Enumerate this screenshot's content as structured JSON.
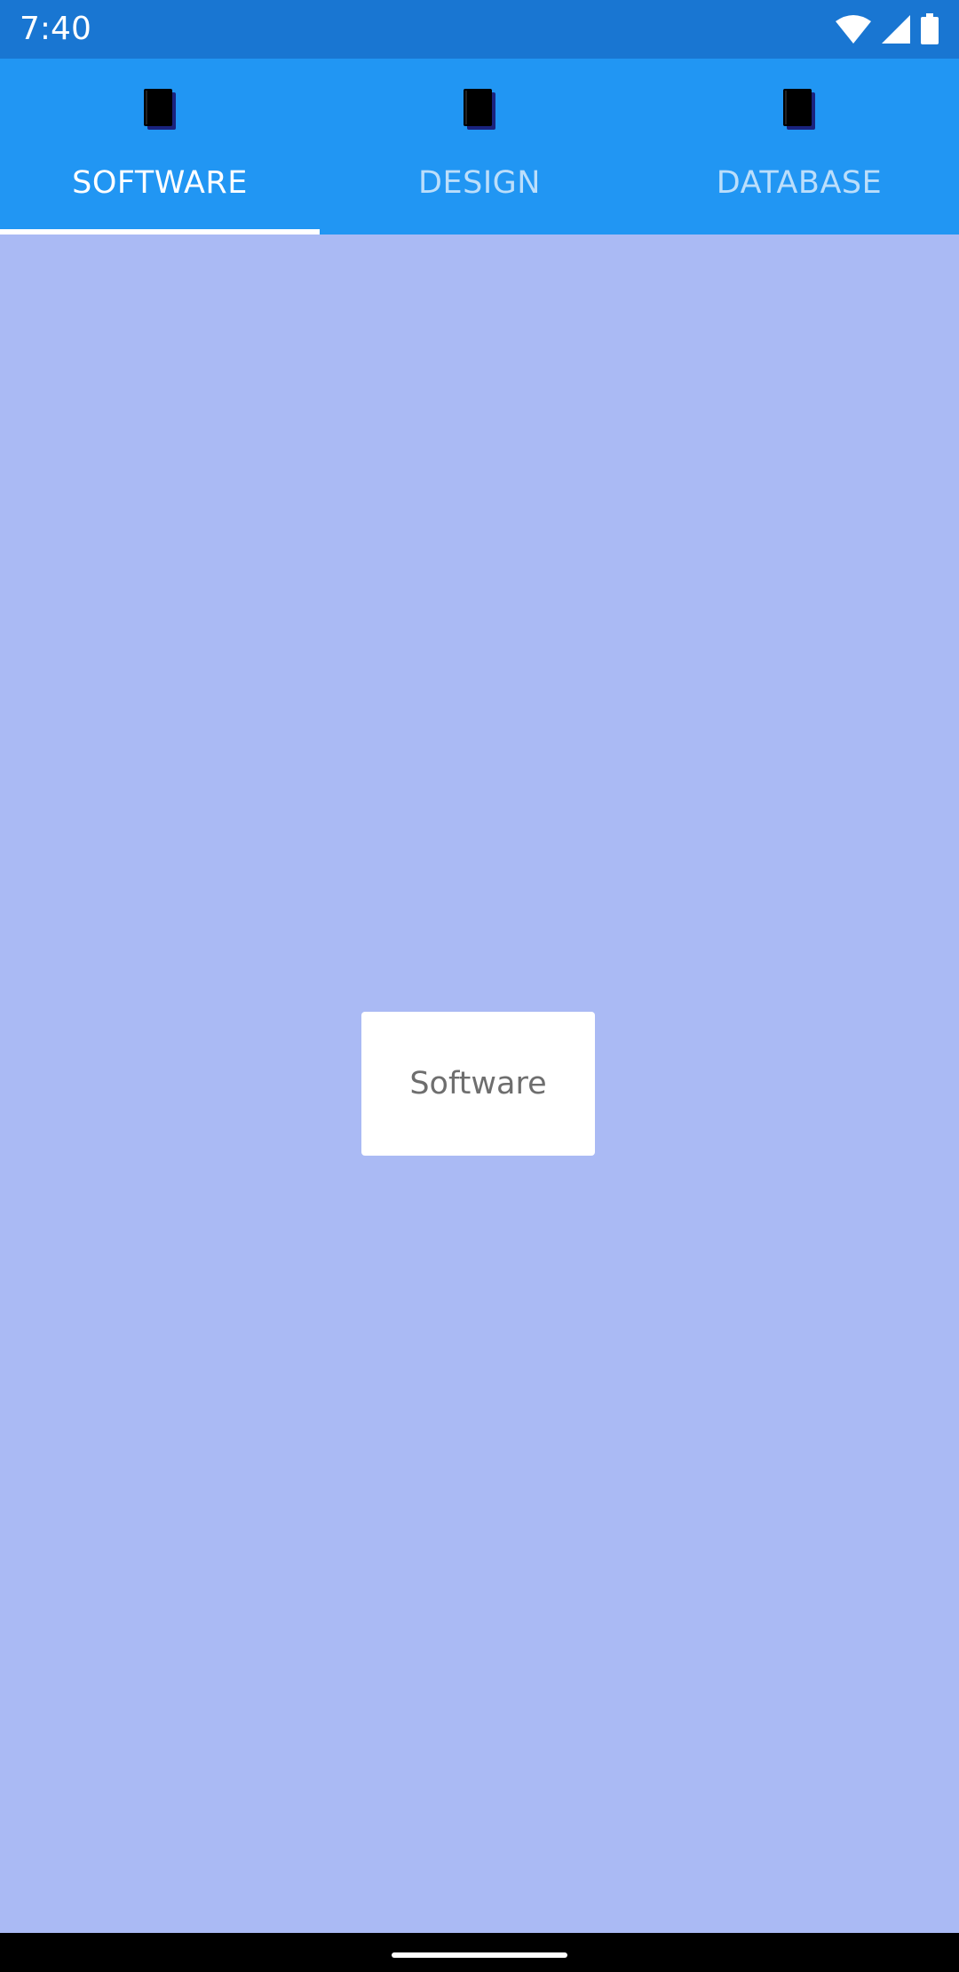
{
  "status_bar": {
    "time": "7:40",
    "icons": [
      "wifi-icon",
      "signal-icon",
      "battery-icon"
    ],
    "background": "#1976D2"
  },
  "tabs": [
    {
      "label": "SOFTWARE",
      "icon": "book-icon",
      "selected": true
    },
    {
      "label": "DESIGN",
      "icon": "book-icon",
      "selected": false
    },
    {
      "label": "DATABASE",
      "icon": "book-icon",
      "selected": false
    }
  ],
  "content": {
    "card_text": "Software",
    "background": "#AABAF4"
  },
  "colors": {
    "tab_bar": "#2196F3",
    "active_tab_text": "#FFFFFF",
    "inactive_tab_text": "#BBDEFB",
    "indicator": "#FFFFFF"
  }
}
